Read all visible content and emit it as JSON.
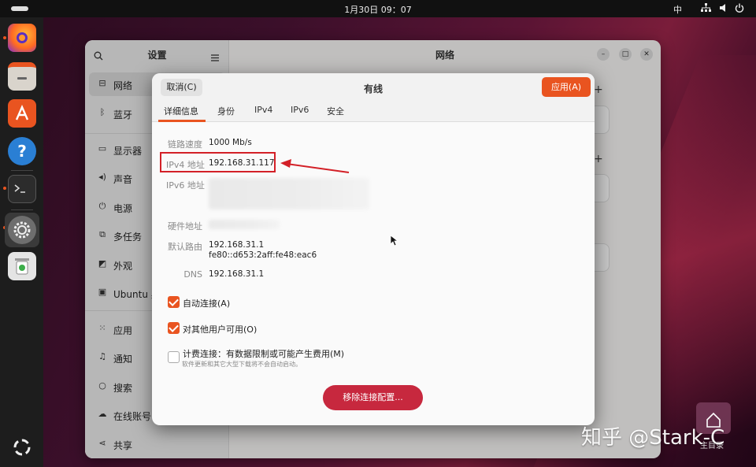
{
  "topbar": {
    "clock": "1月30日 09：07",
    "ime": "中"
  },
  "settings": {
    "sidebar_title": "设置",
    "main_title": "网络",
    "items": [
      {
        "icon": "network",
        "label": "网络"
      },
      {
        "icon": "bluetooth",
        "label": "蓝牙"
      },
      {
        "icon": "display",
        "label": "显示器"
      },
      {
        "icon": "sound",
        "label": "声音"
      },
      {
        "icon": "power",
        "label": "电源"
      },
      {
        "icon": "multitasking",
        "label": "多任务"
      },
      {
        "icon": "appearance",
        "label": "外观"
      },
      {
        "icon": "ubuntu-desktop",
        "label": "Ubuntu 桌"
      },
      {
        "icon": "apps",
        "label": "应用"
      },
      {
        "icon": "notifications",
        "label": "通知"
      },
      {
        "icon": "search",
        "label": "搜索"
      },
      {
        "icon": "online-accounts",
        "label": "在线账号"
      },
      {
        "icon": "sharing",
        "label": "共享"
      }
    ],
    "active_index": 0
  },
  "dialog": {
    "title": "有线",
    "cancel_label": "取消(C)",
    "apply_label": "应用(A)",
    "tabs": [
      "详细信息",
      "身份",
      "IPv4",
      "IPv6",
      "安全"
    ],
    "active_tab": 0,
    "details": {
      "link_speed_label": "链路速度",
      "link_speed": "1000 Mb/s",
      "ipv4_label": "IPv4 地址",
      "ipv4": "192.168.31.117",
      "ipv6_label": "IPv6 地址",
      "hw_label": "硬件地址",
      "route_label": "默认路由",
      "route_v4": "192.168.31.1",
      "route_v6": "fe80::d653:2aff:fe48:eac6",
      "dns_label": "DNS",
      "dns": "192.168.31.1"
    },
    "options": {
      "auto_connect": "自动连接(A)",
      "other_users": "对其他用户可用(O)",
      "metered": "计费连接：有数据限制或可能产生费用(M)",
      "metered_sub": "软件更新和其它大型下载将不会自动启动。"
    },
    "remove_label": "移除连接配置..."
  },
  "desktop": {
    "home_label": "主目录"
  },
  "watermark": "知乎 @Stark-C",
  "colors": {
    "accent": "#e95420",
    "remove": "#c7283e",
    "highlight": "#d32027"
  }
}
